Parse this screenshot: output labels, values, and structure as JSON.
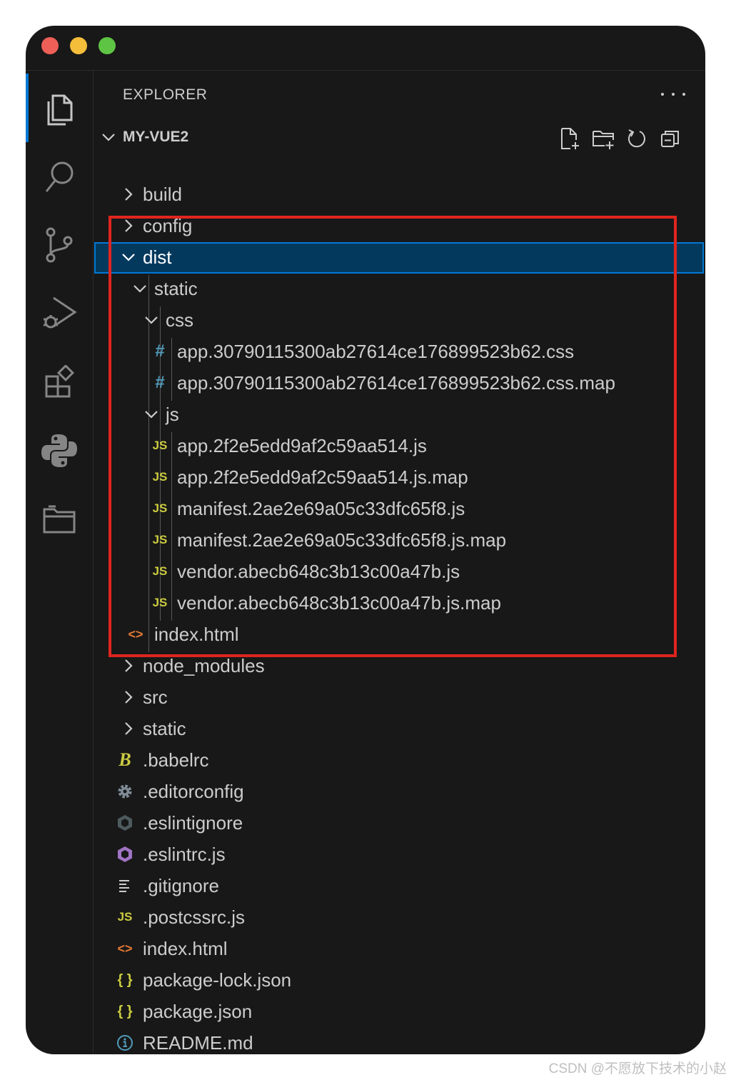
{
  "window": {
    "traffic_lights": [
      "close",
      "minimize",
      "maximize"
    ]
  },
  "activity_bar": {
    "items": [
      {
        "icon": "files-icon",
        "active": true
      },
      {
        "icon": "search-icon"
      },
      {
        "icon": "source-control-icon"
      },
      {
        "icon": "run-debug-icon"
      },
      {
        "icon": "extensions-icon"
      },
      {
        "icon": "python-icon"
      },
      {
        "icon": "folder-icon"
      }
    ]
  },
  "explorer": {
    "title": "EXPLORER",
    "more_label": "…",
    "section_title": "MY-VUE2",
    "toolbar": [
      "new-file-icon",
      "new-folder-icon",
      "refresh-icon",
      "collapse-all-icon"
    ],
    "tree": [
      {
        "label": "build",
        "type": "folder",
        "expanded": false
      },
      {
        "label": "config",
        "type": "folder",
        "expanded": false
      },
      {
        "label": "dist",
        "type": "folder",
        "expanded": true,
        "selected": true
      },
      {
        "label": "static",
        "type": "folder",
        "expanded": true
      },
      {
        "label": "css",
        "type": "folder",
        "expanded": true
      },
      {
        "label": "app.30790115300ab27614ce176899523b62.css",
        "type": "css"
      },
      {
        "label": "app.30790115300ab27614ce176899523b62.css.map",
        "type": "css"
      },
      {
        "label": "js",
        "type": "folder",
        "expanded": true
      },
      {
        "label": "app.2f2e5edd9af2c59aa514.js",
        "type": "js"
      },
      {
        "label": "app.2f2e5edd9af2c59aa514.js.map",
        "type": "js"
      },
      {
        "label": "manifest.2ae2e69a05c33dfc65f8.js",
        "type": "js"
      },
      {
        "label": "manifest.2ae2e69a05c33dfc65f8.js.map",
        "type": "js"
      },
      {
        "label": "vendor.abecb648c3b13c00a47b.js",
        "type": "js"
      },
      {
        "label": "vendor.abecb648c3b13c00a47b.js.map",
        "type": "js"
      },
      {
        "label": "index.html",
        "type": "html"
      },
      {
        "label": "node_modules",
        "type": "folder",
        "expanded": false
      },
      {
        "label": "src",
        "type": "folder",
        "expanded": false
      },
      {
        "label": "static",
        "type": "folder",
        "expanded": false
      },
      {
        "label": ".babelrc",
        "type": "babel"
      },
      {
        "label": ".editorconfig",
        "type": "config"
      },
      {
        "label": ".eslintignore",
        "type": "eslintignore"
      },
      {
        "label": ".eslintrc.js",
        "type": "eslint"
      },
      {
        "label": ".gitignore",
        "type": "gitignore"
      },
      {
        "label": ".postcssrc.js",
        "type": "js"
      },
      {
        "label": "index.html",
        "type": "html"
      },
      {
        "label": "package-lock.json",
        "type": "json"
      },
      {
        "label": "package.json",
        "type": "json"
      },
      {
        "label": "README.md",
        "type": "info"
      }
    ]
  },
  "icon_glyphs": {
    "css": "#",
    "js": "JS",
    "html": "<>",
    "json": "{ }",
    "babel": "B"
  },
  "colors": {
    "background": "#181818",
    "selection": "#04395e",
    "focus_border": "#0078d4",
    "highlight_box": "#e0251f",
    "css_icon": "#519aba",
    "js_icon": "#cbcb41",
    "html_icon": "#e37933",
    "json_icon": "#cbcb41",
    "eslint_icon": "#a074c4"
  },
  "watermark": "CSDN @不愿放下技术的小赵"
}
